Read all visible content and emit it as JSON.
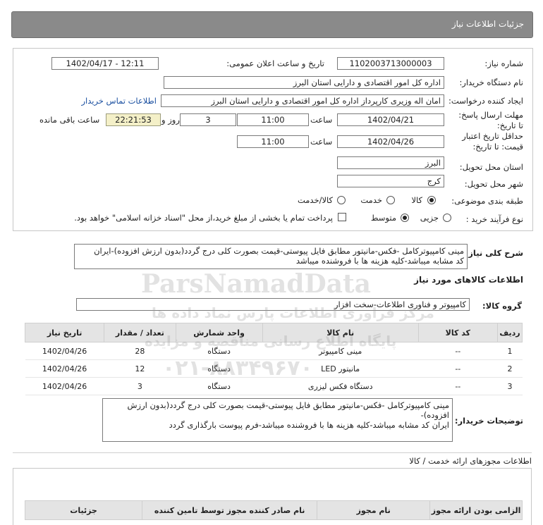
{
  "header": {
    "title": "جزئیات اطلاعات نیاز"
  },
  "form": {
    "need_number_label": "شماره نیاز:",
    "need_number": "1102003713000003",
    "announce_label": "تاریخ و ساعت اعلان عمومی:",
    "announce_value": "1402/04/17 - 12:11",
    "buyer_org_label": "نام دستگاه خریدار:",
    "buyer_org": "اداره کل امور اقتصادی و دارایی استان البرز",
    "requester_label": "ایجاد کننده درخواست:",
    "requester": "امان اله وزیری کارپرداز اداره کل امور اقتصادی و دارایی استان البرز",
    "contact_link": "اطلاعات تماس خریدار",
    "deadline_label": "مهلت ارسال پاسخ: تا تاریخ:",
    "deadline_date": "1402/04/21",
    "time_label": "ساعت",
    "deadline_time": "11:00",
    "days_value": "3",
    "days_label": "روز و",
    "remaining_time": "22:21:53",
    "remaining_label": "ساعت باقی مانده",
    "validity_label": "حداقل تاریخ اعتبار قیمت: تا تاریخ:",
    "validity_date": "1402/04/26",
    "validity_time": "11:00",
    "province_label": "استان محل تحویل:",
    "province": "البرز",
    "city_label": "شهر محل تحویل:",
    "city": "کرج",
    "category_label": "طبقه بندی موضوعی:",
    "category_options": [
      "کالا",
      "خدمت",
      "کالا/خدمت"
    ],
    "category_selected": "کالا",
    "process_label": "نوع فرآیند خرید :",
    "process_options": [
      "جزیی",
      "متوسط"
    ],
    "process_selected": "متوسط",
    "payment_note": "پرداخت تمام یا بخشی از مبلغ خرید،از محل \"اسناد خزانه اسلامی\" خواهد بود."
  },
  "general_desc": {
    "label": "شرح کلی نیاز:",
    "line1": "مینی کامپیوترکامل -فکس-مانیتور مطابق فایل پیوستی-قیمت بصورت کلی درج گردد(بدون ارزش افزوده)-ایران",
    "line2": "کد مشابه میباشد-کلیه هزینه ها با فروشنده میباشد"
  },
  "goods_section": {
    "title": "اطلاعات کالاهای مورد نیاز",
    "group_label": "گروه کالا:",
    "group_value": "کامپیوتر و فناوری اطلاعات-سخت افزار"
  },
  "table": {
    "headers": [
      "ردیف",
      "کد کالا",
      "نام کالا",
      "واحد شمارش",
      "تعداد / مقدار",
      "تاریخ نیاز"
    ],
    "rows": [
      [
        "1",
        "--",
        "مینی کامپیوتر",
        "دستگاه",
        "28",
        "1402/04/26"
      ],
      [
        "2",
        "--",
        "مانیتور LED",
        "دستگاه",
        "12",
        "1402/04/26"
      ],
      [
        "3",
        "--",
        "دستگاه فکس لیزری",
        "دستگاه",
        "3",
        "1402/04/26"
      ]
    ]
  },
  "buyer_notes": {
    "label": "توضیحات خریدار:",
    "line1": "مینی کامپیوترکامل -فکس-مانیتور مطابق فایل پیوستی-قیمت بصورت کلی درج گردد(بدون ارزش افزوده)-",
    "line2": "ایران کد مشابه میباشد-کلیه هزینه ها با فروشنده میباشد-فرم پیوست بارگذاری گردد"
  },
  "permits": {
    "title": "اطلاعات مجوزهای ارائه خدمت / کالا",
    "headers": [
      "الزامی بودن ارائه مجوز",
      "نام مجوز",
      "نام صادر کننده مجوز توسط تامین کننده",
      "جزئیات"
    ]
  },
  "watermark": {
    "brand": "ParsNamadData",
    "line1": "مرکز فراوری اطلاعات پارس نماد داده ها",
    "line2": "پایگاه اطلاع رسانی مناقصه و مزایده",
    "phone": "۰۲۱-۸۸۳۴۹۶۷۰"
  },
  "colors": {
    "titlebar": "#8a8a8a",
    "link": "#1a4fa0",
    "timebox": "#f4f0c8"
  }
}
